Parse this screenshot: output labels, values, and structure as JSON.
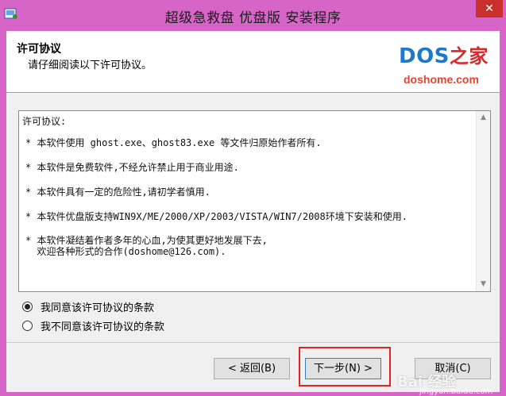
{
  "window": {
    "title": "超级急救盘 优盘版 安装程序",
    "close_glyph": "✕"
  },
  "header": {
    "title": "许可协议",
    "subtitle": "请仔细阅读以下许可协议。",
    "logo_dos": "DOS",
    "logo_zh": "之家",
    "logo_domain": "doshome.com"
  },
  "agreement": {
    "heading": "许可协议:",
    "items": [
      "* 本软件使用 ghost.exe、ghost83.exe 等文件归原始作者所有.",
      "* 本软件是免费软件,不经允许禁止用于商业用途.",
      "* 本软件具有一定的危险性,请初学者慎用.",
      "* 本软件优盘版支持WIN9X/ME/2000/XP/2003/VISTA/WIN7/2008环境下安装和使用.",
      "* 本软件凝结着作者多年的心血,为使其更好地发展下去,\n  欢迎各种形式的合作(doshome@126.com)."
    ]
  },
  "options": {
    "accept": "我同意该许可协议的条款",
    "decline": "我不同意该许可协议的条款",
    "selected": "accept"
  },
  "buttons": {
    "back": "< 返回(B)",
    "next": "下一步(N) >",
    "cancel": "取消(C)"
  },
  "watermark": {
    "main": "Bai 经验",
    "sub": "jingyan.baidu.com"
  },
  "colors": {
    "title_bar": "#d765c8",
    "highlight": "#e02424",
    "logo_blue": "#1e78c8",
    "logo_red": "#d42a2a"
  }
}
